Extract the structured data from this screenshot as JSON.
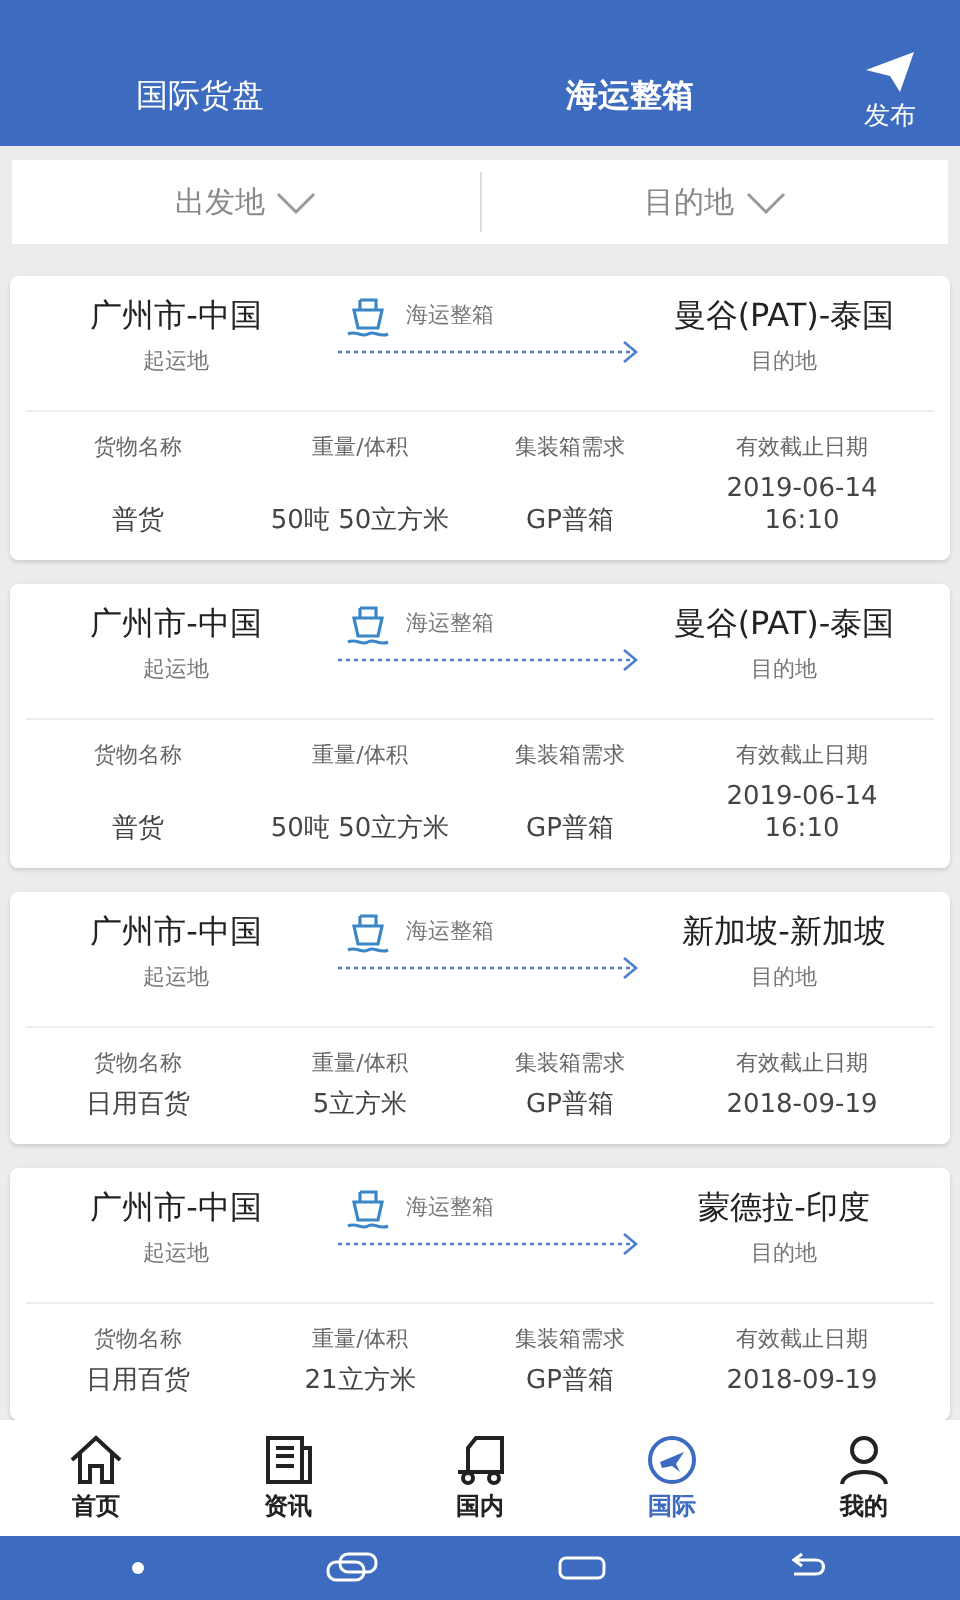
{
  "header": {
    "tabs": [
      {
        "label": "国际货盘",
        "selected": false
      },
      {
        "label": "海运整箱",
        "selected": true
      }
    ],
    "publish": "发布"
  },
  "filters": [
    {
      "label": "出发地"
    },
    {
      "label": "目的地"
    }
  ],
  "cards": [
    {
      "origin": "广州市-中国",
      "origin_label": "起运地",
      "mode": "海运整箱",
      "destination": "曼谷(PAT)-泰国",
      "destination_label": "目的地",
      "fields": [
        {
          "label": "货物名称",
          "value": "普货"
        },
        {
          "label": "重量/体积",
          "value": "50吨 50立方米"
        },
        {
          "label": "集装箱需求",
          "value": "GP普箱"
        },
        {
          "label": "有效截止日期",
          "value": "2019-06-14\n16:10"
        }
      ]
    },
    {
      "origin": "广州市-中国",
      "origin_label": "起运地",
      "mode": "海运整箱",
      "destination": "曼谷(PAT)-泰国",
      "destination_label": "目的地",
      "fields": [
        {
          "label": "货物名称",
          "value": "普货"
        },
        {
          "label": "重量/体积",
          "value": "50吨 50立方米"
        },
        {
          "label": "集装箱需求",
          "value": "GP普箱"
        },
        {
          "label": "有效截止日期",
          "value": "2019-06-14\n16:10"
        }
      ]
    },
    {
      "origin": "广州市-中国",
      "origin_label": "起运地",
      "mode": "海运整箱",
      "destination": "新加坡-新加坡",
      "destination_label": "目的地",
      "fields": [
        {
          "label": "货物名称",
          "value": "日用百货"
        },
        {
          "label": "重量/体积",
          "value": "5立方米"
        },
        {
          "label": "集装箱需求",
          "value": "GP普箱"
        },
        {
          "label": "有效截止日期",
          "value": "2018-09-19"
        }
      ]
    },
    {
      "origin": "广州市-中国",
      "origin_label": "起运地",
      "mode": "海运整箱",
      "destination": "蒙德拉-印度",
      "destination_label": "目的地",
      "fields": [
        {
          "label": "货物名称",
          "value": "日用百货"
        },
        {
          "label": "重量/体积",
          "value": "21立方米"
        },
        {
          "label": "集装箱需求",
          "value": "GP普箱"
        },
        {
          "label": "有效截止日期",
          "value": "2018-09-19"
        }
      ]
    }
  ],
  "nav": [
    {
      "kind": "home",
      "label": "首页",
      "selected": false
    },
    {
      "kind": "news",
      "label": "资讯",
      "selected": false
    },
    {
      "kind": "truck",
      "label": "国内",
      "selected": false
    },
    {
      "kind": "plane",
      "label": "国际",
      "selected": true
    },
    {
      "kind": "user",
      "label": "我的",
      "selected": false
    }
  ]
}
